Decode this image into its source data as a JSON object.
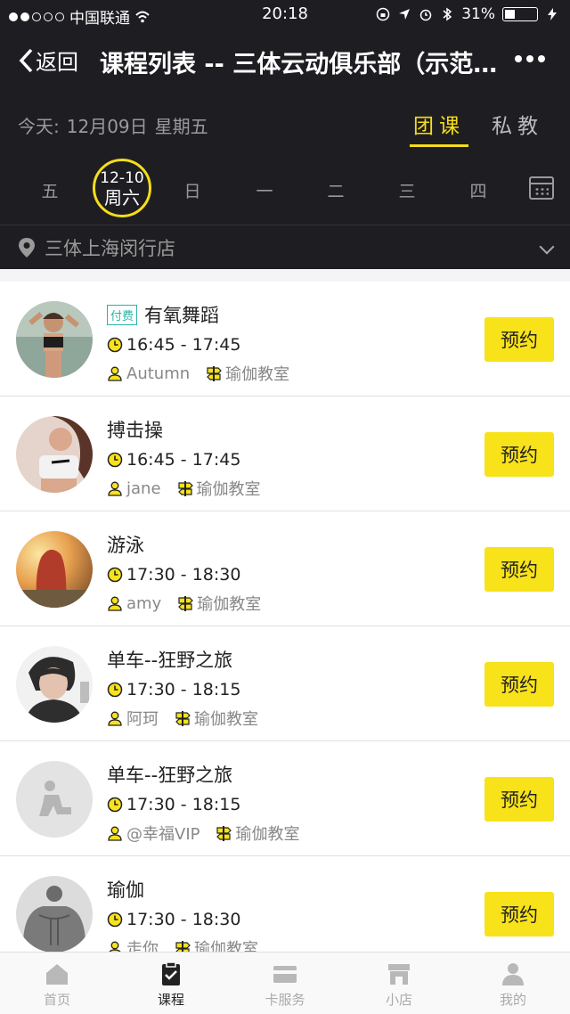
{
  "status_bar": {
    "carrier": "中国联通",
    "time": "20:18",
    "battery": "31%",
    "battery_level": 0.31
  },
  "nav": {
    "back_label": "返回",
    "title": "课程列表 -- 三体云动俱乐部（示范馆）"
  },
  "header": {
    "today_label": "今天:",
    "today_date": "12月09日",
    "today_weekday": "星期五",
    "mode_tabs": [
      {
        "label": "团课",
        "active": true
      },
      {
        "label": "私教",
        "active": false
      }
    ]
  },
  "week": {
    "days": [
      "五",
      "",
      "日",
      "一",
      "二",
      "三",
      "四"
    ],
    "selected": {
      "date": "12-10",
      "weekday": "周六"
    }
  },
  "store": {
    "name": "三体上海闵行店"
  },
  "courses": [
    {
      "tag": "付费",
      "name": "有氧舞蹈",
      "time": "16:45 - 17:45",
      "coach": "Autumn",
      "room": "瑜伽教室",
      "button": "预约",
      "avatar": "fitness-woman"
    },
    {
      "tag": "",
      "name": "搏击操",
      "time": "16:45 - 17:45",
      "coach": "jane",
      "room": "瑜伽教室",
      "button": "预约",
      "avatar": "sport-woman"
    },
    {
      "tag": "",
      "name": "游泳",
      "time": "17:30 - 18:30",
      "coach": "amy",
      "room": "瑜伽教室",
      "button": "预约",
      "avatar": "sunset-woman"
    },
    {
      "tag": "",
      "name": "单车--狂野之旅",
      "time": "17:30 - 18:15",
      "coach": "阿珂",
      "room": "瑜伽教室",
      "button": "预约",
      "avatar": "portrait"
    },
    {
      "tag": "",
      "name": "单车--狂野之旅",
      "time": "17:30 - 18:15",
      "coach": "@幸福VIP",
      "room": "瑜伽教室",
      "button": "预约",
      "avatar": "placeholder"
    },
    {
      "tag": "",
      "name": "瑜伽",
      "time": "17:30 - 18:30",
      "coach": "走你",
      "room": "瑜伽教室",
      "button": "预约",
      "avatar": "bodybuilder"
    }
  ],
  "tabbar": [
    {
      "label": "首页",
      "icon": "home-icon",
      "active": false
    },
    {
      "label": "课程",
      "icon": "clipboard-check-icon",
      "active": true
    },
    {
      "label": "卡服务",
      "icon": "card-icon",
      "active": false
    },
    {
      "label": "小店",
      "icon": "shop-icon",
      "active": false
    },
    {
      "label": "我的",
      "icon": "person-icon",
      "active": false
    }
  ],
  "colors": {
    "accent": "#f8e219",
    "dark": "#1e1e22",
    "tag": "#27b3a6"
  }
}
